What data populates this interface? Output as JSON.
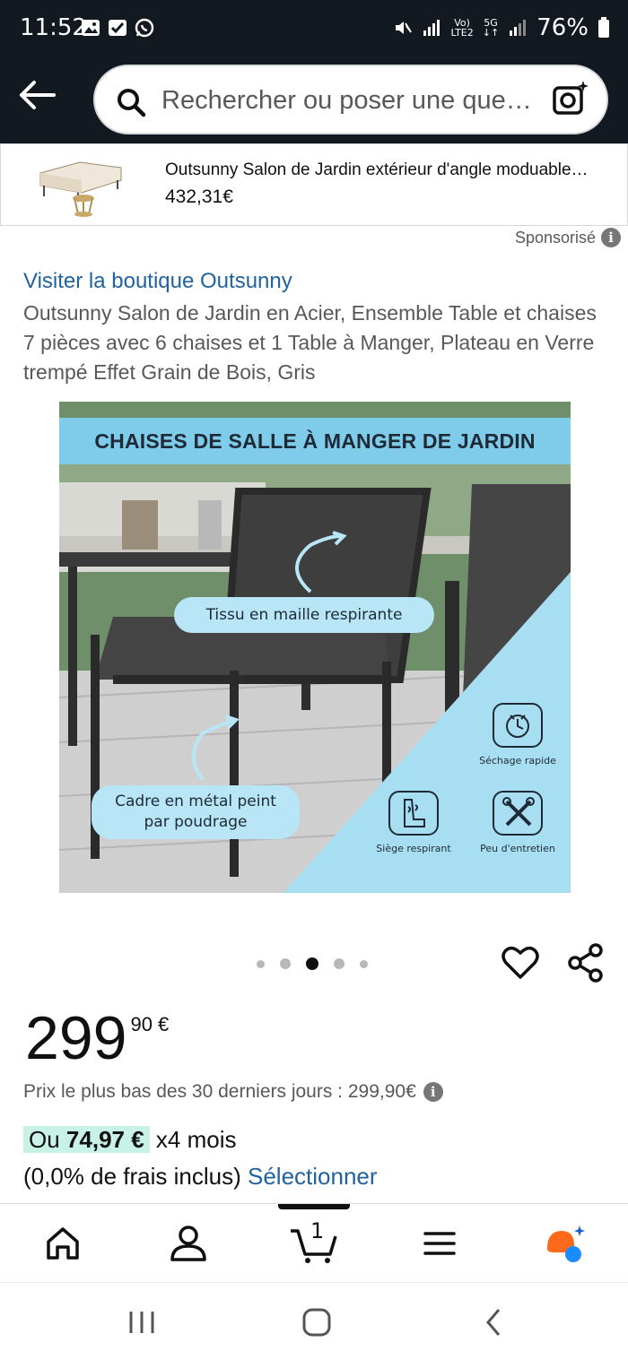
{
  "status_bar": {
    "time": "11:52",
    "net_top": "Vo)",
    "net_bottom": "LTE2",
    "five_g": "5G",
    "battery": "76%"
  },
  "search": {
    "placeholder": "Rechercher ou poser une que…"
  },
  "sponsored_banner": {
    "title": "Outsunny Salon de Jardin extérieur d'angle moduable…",
    "price": "432,31€",
    "label": "Sponsorisé"
  },
  "product": {
    "store_link": "Visiter la boutique Outsunny",
    "title": "Outsunny Salon de Jardin en Acier, Ensemble Table et chaises 7 pièces avec 6 chaises et 1 Table à Manger, Plateau en Verre trempé Effet Grain de Bois, Gris",
    "image": {
      "heading": "CHAISES DE SALLE À MANGER DE JARDIN",
      "callout_mesh": "Tissu en maille respirante",
      "callout_frame_line1": "Cadre en métal peint",
      "callout_frame_line2": "par poudrage",
      "feature_quick_dry": "Séchage rapide",
      "feature_breathable_seat": "Siège respirant",
      "feature_low_maintenance": "Peu d'entretien"
    },
    "carousel": {
      "total": 5,
      "active_index": 2
    }
  },
  "pricing": {
    "whole": "299",
    "fraction": "90 €",
    "lowest_30_days": "Prix le plus bas des 30 derniers jours : 299,90€",
    "installment_prefix": "Ou",
    "installment_amount": "74,97 €",
    "installment_suffix": "x4 mois",
    "fees_text": "(0,0% de frais inclus)",
    "select_link": "Sélectionner"
  },
  "bottom_nav": {
    "cart_count": "1"
  },
  "colors": {
    "header_bg": "#131921",
    "link": "#2162a1",
    "installment_highlight": "#c9f2e7",
    "image_heading_bg": "#7ecbea"
  }
}
